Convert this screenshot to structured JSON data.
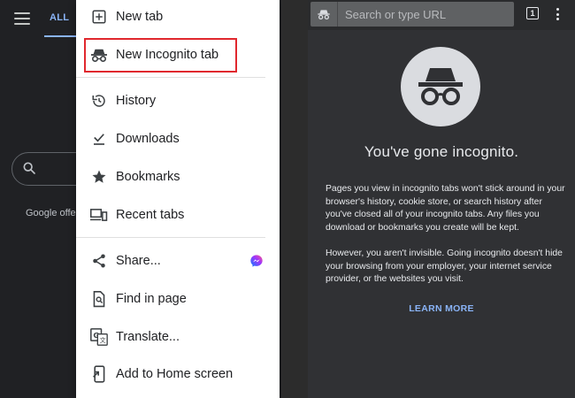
{
  "left_screen": {
    "tab_label": "ALL",
    "promo_text": "Google offe"
  },
  "menu": {
    "items": [
      {
        "label": "New tab",
        "icon": "add-box-icon"
      },
      {
        "label": "New Incognito tab",
        "icon": "incognito-icon"
      },
      {
        "label": "History",
        "icon": "history-icon"
      },
      {
        "label": "Downloads",
        "icon": "download-icon"
      },
      {
        "label": "Bookmarks",
        "icon": "star-icon"
      },
      {
        "label": "Recent tabs",
        "icon": "devices-icon"
      },
      {
        "label": "Share...",
        "icon": "share-icon"
      },
      {
        "label": "Find in page",
        "icon": "find-in-page-icon"
      },
      {
        "label": "Translate...",
        "icon": "translate-icon"
      },
      {
        "label": "Add to Home screen",
        "icon": "add-to-home-icon"
      }
    ],
    "highlighted_item": "New Incognito tab",
    "highlight_color": "#e0282e"
  },
  "incognito_page": {
    "url_placeholder": "Search or type URL",
    "tab_count": "1",
    "heading": "You've gone incognito.",
    "paragraph_1": "Pages you view in incognito tabs won't stick around in your browser's history, cookie store, or search history after you've closed all of your incognito tabs. Any files you download or bookmarks you create will be kept.",
    "paragraph_2": "However, you aren't invisible. Going incognito doesn't hide your browsing from your employer, your internet service provider, or the websites you visit.",
    "learn_more": "LEARN MORE",
    "link_color": "#8ab4f8"
  }
}
